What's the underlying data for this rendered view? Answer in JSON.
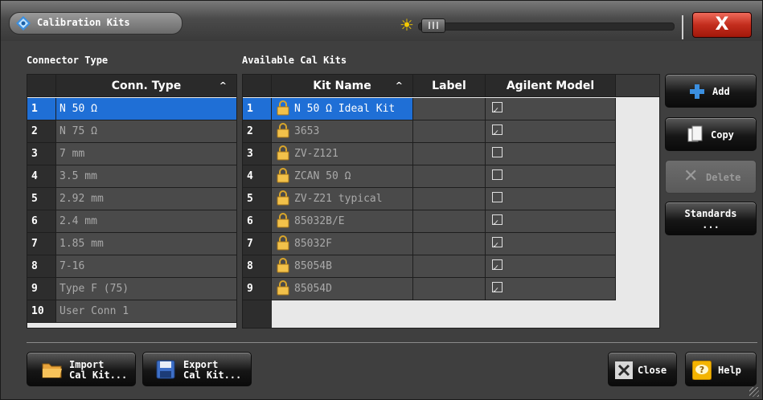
{
  "window": {
    "title": "Calibration Kits",
    "close_label": "X"
  },
  "connector_section": {
    "label": "Connector Type",
    "header": "Conn. Type",
    "sort_indicator": "^",
    "rows": [
      {
        "num": "1",
        "name": "N 50 Ω"
      },
      {
        "num": "2",
        "name": "N 75 Ω"
      },
      {
        "num": "3",
        "name": "7 mm"
      },
      {
        "num": "4",
        "name": "3.5 mm"
      },
      {
        "num": "5",
        "name": "2.92 mm"
      },
      {
        "num": "6",
        "name": "2.4 mm"
      },
      {
        "num": "7",
        "name": "1.85 mm"
      },
      {
        "num": "8",
        "name": "7-16"
      },
      {
        "num": "9",
        "name": "Type F (75)"
      },
      {
        "num": "10",
        "name": "User Conn 1"
      }
    ]
  },
  "calkits_section": {
    "label": "Available Cal Kits",
    "headers": {
      "kit_name": "Kit Name",
      "label": "Label",
      "agilent": "Agilent Model"
    },
    "sort_indicator": "^",
    "rows": [
      {
        "num": "1",
        "kit": "N 50 Ω Ideal Kit",
        "label": "",
        "agilent": true
      },
      {
        "num": "2",
        "kit": "3653",
        "label": "",
        "agilent": true
      },
      {
        "num": "3",
        "kit": "ZV-Z121",
        "label": "",
        "agilent": false
      },
      {
        "num": "4",
        "kit": "ZCAN 50 Ω",
        "label": "",
        "agilent": false
      },
      {
        "num": "5",
        "kit": "ZV-Z21 typical",
        "label": "",
        "agilent": false
      },
      {
        "num": "6",
        "kit": "85032B/E",
        "label": "",
        "agilent": true
      },
      {
        "num": "7",
        "kit": "85032F",
        "label": "",
        "agilent": true
      },
      {
        "num": "8",
        "kit": "85054B",
        "label": "",
        "agilent": true
      },
      {
        "num": "9",
        "kit": "85054D",
        "label": "",
        "agilent": true
      }
    ]
  },
  "buttons": {
    "add": "Add",
    "copy": "Copy",
    "delete": "Delete",
    "standards_line1": "Standards",
    "standards_line2": "...",
    "import_line1": "Import",
    "import_line2": "Cal Kit...",
    "export_line1": "Export",
    "export_line2": "Cal Kit...",
    "close": "Close",
    "help": "Help"
  },
  "colors": {
    "selection": "#1f6fd6",
    "title_close": "#c22d1d",
    "brightness_icon": "#f3c800"
  }
}
